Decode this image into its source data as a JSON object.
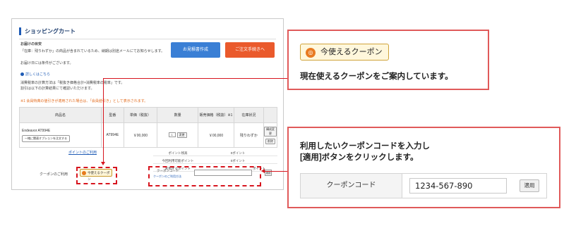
{
  "cart": {
    "title": "ショッピングカート",
    "delivery_heading": "お届けの目安",
    "delivery_note1": "「在庫：残りわずか」の商品が含まれているため、納期は別途メールにてお知らせします。",
    "delivery_note2": "お届け日には条件がございます。",
    "quote_button": "お見積書作成",
    "order_button": "ご注文手続きへ",
    "details_link": "詳しくはこちら",
    "tax_note1": "消費税率の計算方法は「税抜き価格合計×消費税率の税率」です。",
    "tax_note2": "割引は以下の計算結果にて確認いただけます。",
    "discount_note": "※1 会員特典の値引きが適用された場合は、「会員値引き」として表示されます。",
    "table_headers": [
      "商品名",
      "型番",
      "単価（税抜）",
      "数量",
      "販売価格（税抜）※1",
      "在庫状況",
      ""
    ],
    "product_name": "Endeavor AT994E",
    "product_option": "一緒に関連オプションを注文する",
    "product_model": "AT994E",
    "product_price": "￥00,000",
    "product_qty": "1",
    "qty_change": "変更",
    "product_total": "￥00,000",
    "stock_status": "残りわずか",
    "config_change": "構成変更",
    "delete": "削除",
    "points_link": "ポイントのご利用",
    "points_rows": [
      {
        "k": "ポイント残高",
        "v": "0ポイント"
      },
      {
        "k": "今回利用可能ポイント",
        "v": "0ポイント"
      },
      {
        "k": "利用するポイント",
        "v": "ポイント"
      }
    ],
    "coupon_row_label": "クーポンのご利用",
    "coupon_small_button": "今使えるクーポン",
    "coupon_code_label": "クーポンコード",
    "coupon_usage_link": "クーポンのご利用方法",
    "apply_small": "適用"
  },
  "callout1": {
    "coupon_badge": "今使えるクーポン",
    "text": "現在使えるクーポンをご案内しています。"
  },
  "callout2": {
    "line1": "利用したいクーポンコードを入力し",
    "line2": "[適用]ボタンをクリックします。",
    "field_label": "クーポンコード",
    "field_value": "1234-567-890",
    "apply_button": "適用"
  },
  "colors": {
    "accent_red": "#d7151e",
    "callout_border": "#e05a5a",
    "quote_blue": "#3a7fd5",
    "order_orange": "#ea5a2c",
    "coupon_icon": "#e87b22"
  },
  "icons": [
    "coupon-icon",
    "info-icon"
  ]
}
